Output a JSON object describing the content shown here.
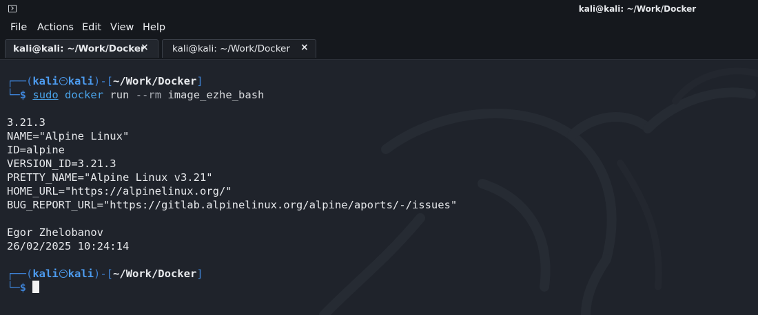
{
  "window": {
    "title": "kali@kali: ~/Work/Docker"
  },
  "menu": {
    "items": [
      "File",
      "Actions",
      "Edit",
      "View",
      "Help"
    ]
  },
  "tabs": [
    {
      "label": "kali@kali: ~/Work/Docker",
      "close": "×",
      "active": true
    },
    {
      "label": "kali@kali: ~/Work/Docker",
      "close": "×",
      "active": false
    }
  ],
  "terminal": {
    "prompt": {
      "open": "┌──(",
      "user": "kali",
      "host": "kali",
      "mid": ")-[",
      "path": "~/Work/Docker",
      "close": "]",
      "corner": "└─",
      "dollar": "$"
    },
    "command": {
      "sudo": "sudo",
      "docker": "docker",
      "run": "run",
      "flag": "--rm",
      "image": "image_ezhe_bash"
    },
    "output": [
      "3.21.3",
      "NAME=\"Alpine Linux\"",
      "ID=alpine",
      "VERSION_ID=3.21.3",
      "PRETTY_NAME=\"Alpine Linux v3.21\"",
      "HOME_URL=\"https://alpinelinux.org/\"",
      "BUG_REPORT_URL=\"https://gitlab.alpinelinux.org/alpine/aports/-/issues\""
    ],
    "output2": [
      "Egor Zhelobanov",
      "26/02/2025 10:24:14"
    ]
  },
  "colors": {
    "background": "#1f232b",
    "chrome": "#15181d",
    "prompt_blue": "#3e83d6",
    "text": "#e6e8eb"
  }
}
